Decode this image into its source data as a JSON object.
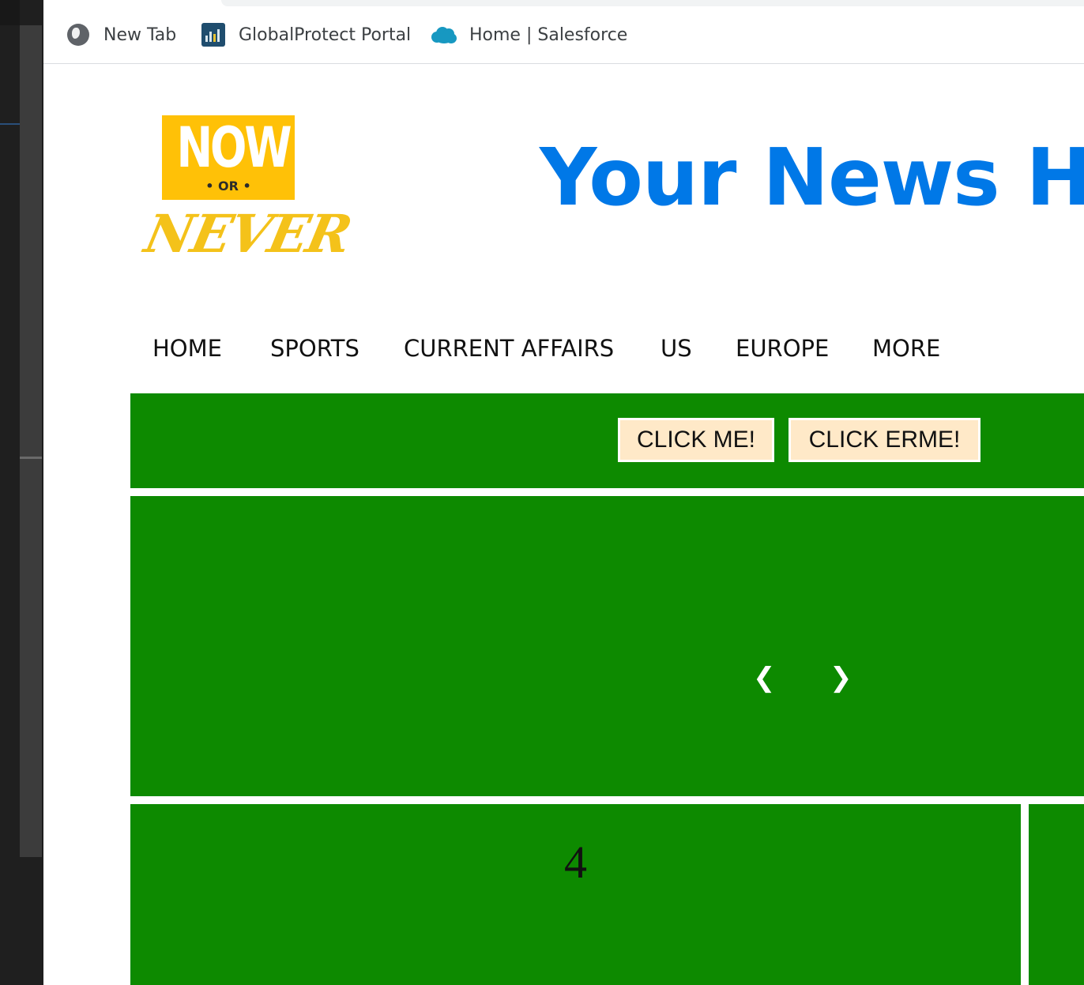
{
  "bookmarks": [
    {
      "label": "New Tab",
      "icon": "globe-icon"
    },
    {
      "label": "GlobalProtect Portal",
      "icon": "globalprotect-icon"
    },
    {
      "label": "Home | Salesforce",
      "icon": "salesforce-cloud-icon"
    }
  ],
  "logo": {
    "top": "NOW",
    "middle": "• OR •",
    "bottom": "NEVER"
  },
  "headline": "Your News H",
  "nav": [
    "HOME",
    "SPORTS",
    "CURRENT AFFAIRS",
    "US",
    "EUROPE",
    "MORE"
  ],
  "buttons": {
    "click_me": "CLICK ME!",
    "click_erme": "CLICK ERME!"
  },
  "carousel": {
    "prev": "❮",
    "next": "❯"
  },
  "cards": [
    {
      "number": "4"
    }
  ],
  "colors": {
    "accent": "#0078e7",
    "panel_green": "#0d8a00",
    "button_bg": "#ffe9c8",
    "logo_yellow": "#ffc107"
  }
}
